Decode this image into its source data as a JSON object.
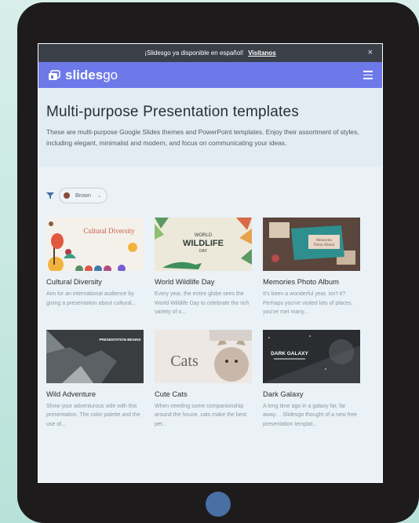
{
  "banner": {
    "text": "¡Slidesgo ya disponible en español!",
    "link": "Visítanos",
    "close": "×"
  },
  "nav": {
    "logo_part1": "slides",
    "logo_part2": "go"
  },
  "hero": {
    "title": "Multi-purpose Presentation templates",
    "description": "These are multi-purpose Google Slides themes and PowerPoint templates. Enjoy their assortment of styles, including elegant, minimalist and modern, and focus on communicating your ideas."
  },
  "filter": {
    "color_label": "Brown",
    "color_value": "#8b4b3a"
  },
  "templates": [
    {
      "title": "Cultural Diversity",
      "desc": "Aim for an international audience by giving a presentation about cultural...",
      "thumb_text": "Cultural Diversity"
    },
    {
      "title": "World Wildlife Day",
      "desc": "Every year, the entire globe sees the World Wildlife Day to celebrate the rich variety of o...",
      "thumb_text": "WORLD WILDLIFE DAY"
    },
    {
      "title": "Memories Photo Album",
      "desc": "It's been a wonderful year, isn't it? Perhaps you've visited lots of places, you've met many...",
      "thumb_text": "Memories Photo Album"
    },
    {
      "title": "Wild Adventure",
      "desc": "Show your adventurous side with this presentation. The color palette and the use of...",
      "thumb_text": "PRESENTATION BEGINS"
    },
    {
      "title": "Cute Cats",
      "desc": "When needing some companionship around the house, cats make the best pet...",
      "thumb_text": "Cats"
    },
    {
      "title": "Dark Galaxy",
      "desc": "A long time ago in a galaxy far, far away… Slidesgo thought of a new free presentation templat...",
      "thumb_text": "DARK GALAXY"
    }
  ],
  "colors": {
    "navbar": "#6d79e8",
    "banner": "#3a3f48",
    "tablet": "#1d1b1c"
  }
}
